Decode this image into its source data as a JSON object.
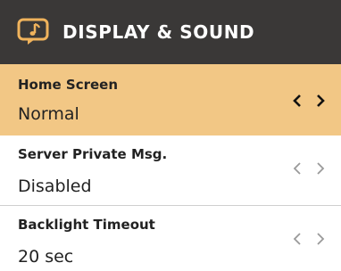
{
  "header": {
    "title": "DISPLAY & SOUND",
    "icon": "music-note-box-icon",
    "background": "#3a3837",
    "icon_color": "#f0b35c"
  },
  "colors": {
    "selected_row": "#f2c785",
    "arrow_active": "#111111",
    "arrow_inactive": "#9a9a9a",
    "text": "#222222"
  },
  "settings": [
    {
      "label": "Home Screen",
      "value": "Normal",
      "selected": true
    },
    {
      "label": "Server Private Msg.",
      "value": "Disabled",
      "selected": false
    },
    {
      "label": "Backlight Timeout",
      "value": "20 sec",
      "selected": false
    }
  ],
  "arrow_icons": {
    "left": "chevron-left-icon",
    "right": "chevron-right-icon"
  }
}
